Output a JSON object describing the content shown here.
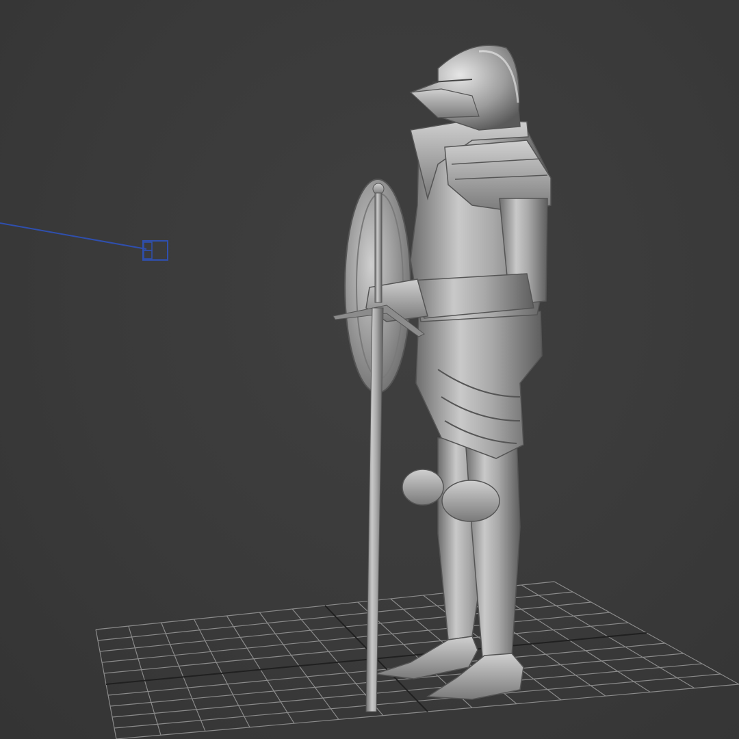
{
  "viewport": {
    "background_color": "#3a3a3a",
    "grid_color": "#9a9a9a",
    "grid_axis_color": "#1c1c1c",
    "light_helper_color": "#2f4fae",
    "model_color": "#a8a8a8"
  },
  "scene": {
    "model_name": "knight-armor",
    "light_icon": "target-light-icon"
  }
}
